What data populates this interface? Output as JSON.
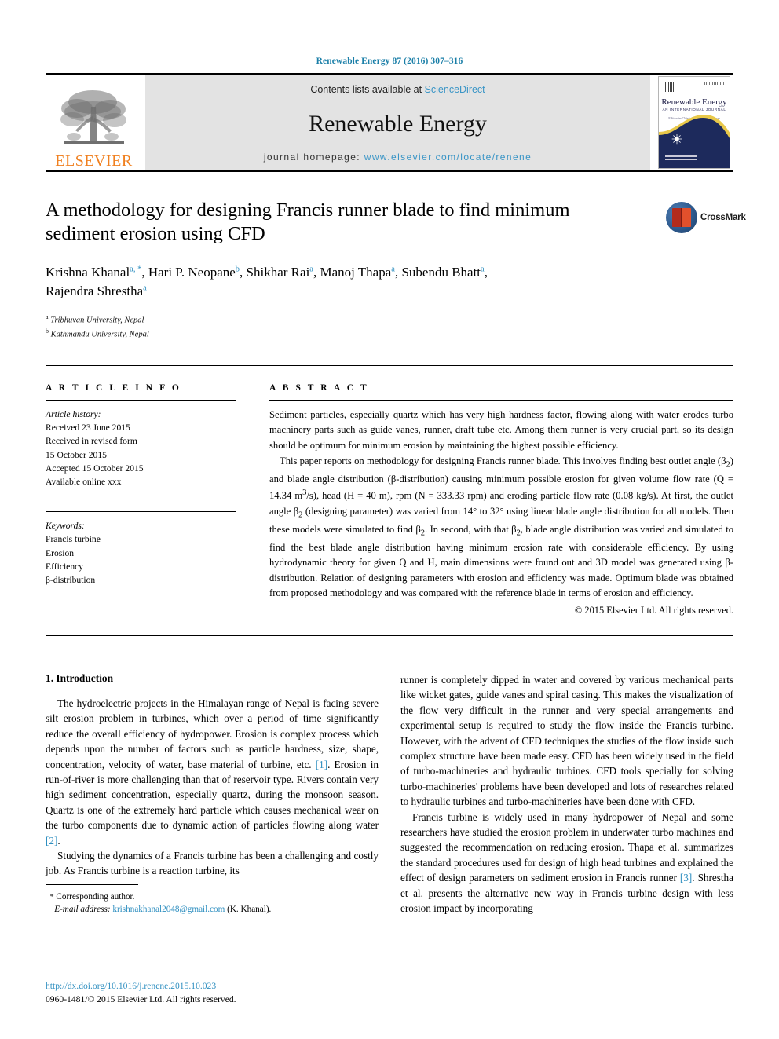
{
  "running_head": "Renewable Energy 87 (2016) 307–316",
  "masthead": {
    "publisher_wordmark": "ELSEVIER",
    "contents_prefix": "Contents lists available at ",
    "contents_link": "ScienceDirect",
    "journal_name": "Renewable Energy",
    "homepage_prefix": "journal homepage: ",
    "homepage_url": "www.elsevier.com/locate/renene",
    "cover": {
      "title": "Renewable Energy",
      "subtitle": "AN INTERNATIONAL JOURNAL",
      "tagline": "Editor-in-Chief: Soteris A. Kalogirou"
    }
  },
  "article": {
    "title": "A methodology for designing Francis runner blade to find minimum sediment erosion using CFD",
    "crossmark_label": "CrossMark",
    "authors_line1": "Krishna Khanal a, *, Hari P. Neopane b, Shikhar Rai a, Manoj Thapa a, Subendu Bhatt a,",
    "authors_line2": "Rajendra Shrestha a",
    "authors": [
      {
        "name": "Krishna Khanal",
        "marks": "a, *"
      },
      {
        "name": "Hari P. Neopane",
        "marks": "b"
      },
      {
        "name": "Shikhar Rai",
        "marks": "a"
      },
      {
        "name": "Manoj Thapa",
        "marks": "a"
      },
      {
        "name": "Subendu Bhatt",
        "marks": "a"
      },
      {
        "name": "Rajendra Shrestha",
        "marks": "a"
      }
    ],
    "affiliations": [
      {
        "mark": "a",
        "text": "Tribhuvan University, Nepal"
      },
      {
        "mark": "b",
        "text": "Kathmandu University, Nepal"
      }
    ]
  },
  "article_info": {
    "heading": "A R T I C L E   I N F O",
    "history_label": "Article history:",
    "history": [
      "Received 23 June 2015",
      "Received in revised form",
      "15 October 2015",
      "Accepted 15 October 2015",
      "Available online xxx"
    ],
    "keywords_label": "Keywords:",
    "keywords": [
      "Francis turbine",
      "Erosion",
      "Efficiency",
      "β-distribution"
    ]
  },
  "abstract": {
    "heading": "A B S T R A C T",
    "paragraph1": "Sediment particles, especially quartz which has very high hardness factor, flowing along with water erodes turbo machinery parts such as guide vanes, runner, draft tube etc. Among them runner is very crucial part, so its design should be optimum for minimum erosion by maintaining the highest possible efficiency.",
    "paragraph2": "This paper reports on methodology for designing Francis runner blade. This involves finding best outlet angle (β2) and blade angle distribution (β-distribution) causing minimum possible erosion for given volume flow rate (Q = 14.34 m3/s), head (H = 40 m), rpm (N = 333.33 rpm) and eroding particle flow rate (0.08 kg/s). At first, the outlet angle β2 (designing parameter) was varied from 14° to 32° using linear blade angle distribution for all models. Then these models were simulated to find β2. In second, with that β2, blade angle distribution was varied and simulated to find the best blade angle distribution having minimum erosion rate with considerable efficiency. By using hydrodynamic theory for given Q and H, main dimensions were found out and 3D model was generated using β-distribution. Relation of designing parameters with erosion and efficiency was made. Optimum blade was obtained from proposed methodology and was compared with the reference blade in terms of erosion and efficiency.",
    "copyright": "© 2015 Elsevier Ltd. All rights reserved."
  },
  "body": {
    "section_heading": "1. Introduction",
    "left_paragraph1": "The hydroelectric projects in the Himalayan range of Nepal is facing severe silt erosion problem in turbines, which over a period of time significantly reduce the overall efficiency of hydropower. Erosion is complex process which depends upon the number of factors such as particle hardness, size, shape, concentration, velocity of water, base material of turbine, etc. [1]. Erosion in run-of-river is more challenging than that of reservoir type. Rivers contain very high sediment concentration, especially quartz, during the monsoon season. Quartz is one of the extremely hard particle which causes mechanical wear on the turbo components due to dynamic action of particles flowing along water [2].",
    "left_paragraph2": "Studying the dynamics of a Francis turbine has been a challenging and costly job. As Francis turbine is a reaction turbine, its",
    "right_paragraph1": "runner is completely dipped in water and covered by various mechanical parts like wicket gates, guide vanes and spiral casing. This makes the visualization of the flow very difficult in the runner and very special arrangements and experimental setup is required to study the flow inside the Francis turbine. However, with the advent of CFD techniques the studies of the flow inside such complex structure have been made easy. CFD has been widely used in the field of turbo-machineries and hydraulic turbines. CFD tools specially for solving turbo-machineries' problems have been developed and lots of researches related to hydraulic turbines and turbo-machineries have been done with CFD.",
    "right_paragraph2": "Francis turbine is widely used in many hydropower of Nepal and some researchers have studied the erosion problem in underwater turbo machines and suggested the recommendation on reducing erosion. Thapa et al. summarizes the standard procedures used for design of high head turbines and explained the effect of design parameters on sediment erosion in Francis runner [3]. Shrestha et al. presents the alternative new way in Francis turbine design with less erosion impact by incorporating"
  },
  "footnotes": {
    "corresponding_marker": "*",
    "corresponding_label": "Corresponding author.",
    "email_label": "E-mail address:",
    "email": "krishnakhanal2048@gmail.com",
    "email_owner": "(K. Khanal)."
  },
  "footer": {
    "doi": "http://dx.doi.org/10.1016/j.renene.2015.10.023",
    "issn_copyright": "0960-1481/© 2015 Elsevier Ltd. All rights reserved."
  },
  "colors": {
    "link_blue": "#2f8fc0",
    "header_blue": "#1b7fa8",
    "elsevier_orange": "#F08020",
    "masthead_gray": "#e3e3e3"
  }
}
